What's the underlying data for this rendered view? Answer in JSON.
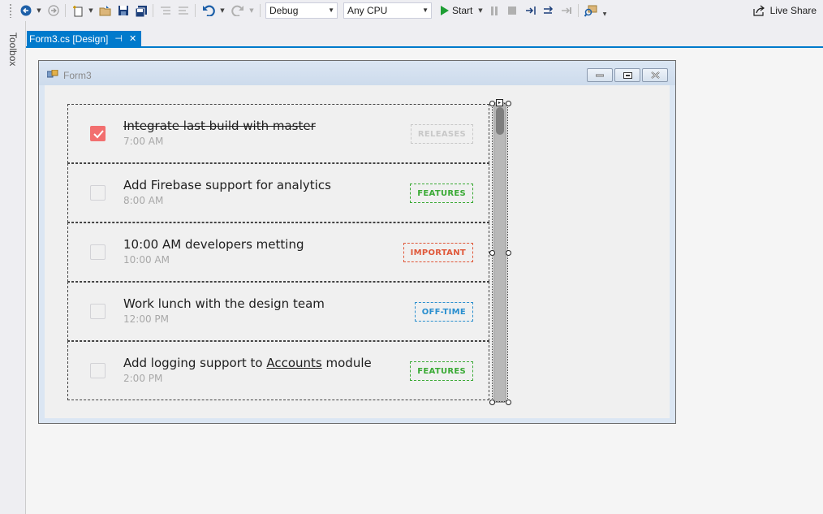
{
  "toolbar": {
    "configuration": "Debug",
    "platform": "Any CPU",
    "start_label": "Start",
    "live_share_label": "Live Share"
  },
  "toolbox": {
    "label": "Toolbox"
  },
  "tab": {
    "title": "Form3.cs [Design]"
  },
  "form": {
    "caption": "Form3"
  },
  "tasks": [
    {
      "title": "Integrate last build with master",
      "time": "7:00 AM",
      "tag": "RELEASES",
      "tag_color": "#c8c8c8",
      "done": true
    },
    {
      "title": "Add Firebase support for analytics",
      "time": "8:00 AM",
      "tag": "FEATURES",
      "tag_color": "#3aaa35",
      "done": false
    },
    {
      "title": "10:00 AM developers metting",
      "time": "10:00 AM",
      "tag": "IMPORTANT",
      "tag_color": "#e0583a",
      "done": false
    },
    {
      "title": "Work lunch with the design team",
      "time": "12:00 PM",
      "tag": "OFF-TIME",
      "tag_color": "#2a8fcf",
      "done": false
    },
    {
      "title_pre": "Add logging support to ",
      "title_link": "Accounts",
      "title_post": " module",
      "time": "2:00 PM",
      "tag": "FEATURES",
      "tag_color": "#3aaa35",
      "done": false
    }
  ],
  "colors": {
    "accent": "#007acc",
    "checked": "#f26f6f",
    "start_green": "#1e9e34"
  }
}
